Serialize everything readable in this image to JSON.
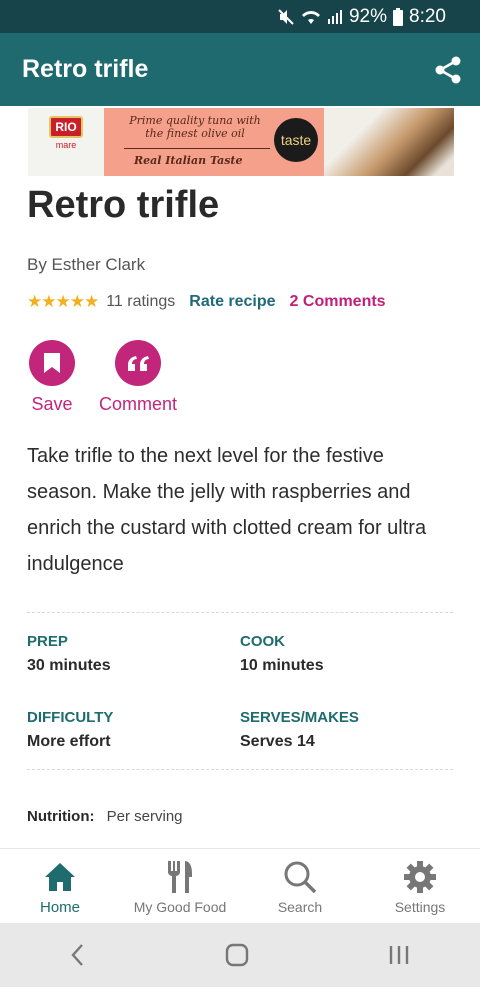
{
  "status_bar": {
    "battery": "92%",
    "time": "8:20"
  },
  "app_bar": {
    "title": "Retro trifle"
  },
  "ad": {
    "brand": "RIO",
    "brand_sub": "mare",
    "line1": "Prime quality tuna with the finest olive oil",
    "line2": "Real Italian Taste",
    "badge": "taste"
  },
  "recipe": {
    "title": "Retro trifle",
    "author": "By Esther Clark",
    "stars": "★★★★★",
    "ratings": "11 ratings",
    "rate_label": "Rate recipe",
    "comments_label": "2 Comments",
    "description": "Take trifle to the next level for the festive season. Make the jelly with raspberries and enrich the custard with clotted cream for ultra indulgence"
  },
  "actions": {
    "save": "Save",
    "comment": "Comment"
  },
  "info": {
    "prep_label": "PREP",
    "prep_value": "30 minutes",
    "cook_label": "COOK",
    "cook_value": "10 minutes",
    "difficulty_label": "DIFFICULTY",
    "difficulty_value": "More effort",
    "serves_label": "SERVES/MAKES",
    "serves_value": "Serves 14"
  },
  "nutrition": {
    "label": "Nutrition:",
    "value": "Per serving"
  },
  "bottom_nav": {
    "home": "Home",
    "my_good_food": "My Good Food",
    "search": "Search",
    "settings": "Settings"
  },
  "colors": {
    "app_bar": "#1f6a6e",
    "status_bar": "#17434a",
    "accent_pink": "#c2267a",
    "teal_text": "#1e6c6e"
  }
}
